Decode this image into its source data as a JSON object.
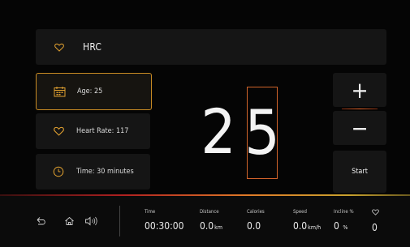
{
  "header": {
    "title": "HRC",
    "icon": "heart-icon"
  },
  "params": [
    {
      "label": "Age: 25",
      "icon": "calendar-icon",
      "active": true
    },
    {
      "label": "Heart Rate: 117",
      "icon": "heart-icon",
      "active": false
    },
    {
      "label": "Time:  30 minutes",
      "icon": "clock-icon",
      "active": false
    }
  ],
  "display": {
    "digit1": "2",
    "digit2": "5",
    "selected_digit": 2
  },
  "controls": {
    "plus": "+",
    "minus": "−",
    "start": "Start"
  },
  "footer": {
    "nav": [
      "back-icon",
      "home-icon",
      "sound-icon"
    ],
    "stats": {
      "time": {
        "label": "Time",
        "value": "00:30:00",
        "unit": ""
      },
      "distance": {
        "label": "Distance",
        "value": "0.0",
        "unit": "km"
      },
      "calories": {
        "label": "Calories",
        "value": "0.0",
        "unit": ""
      },
      "speed": {
        "label": "Speed",
        "value": "0.0",
        "unit": "km/h"
      },
      "incline": {
        "label": "Incline %",
        "value": "0",
        "unit": "%"
      },
      "heart": {
        "label_icon": "heart-icon",
        "value": "0"
      }
    }
  },
  "colors": {
    "accent_orange": "#e4652a",
    "accent_gold": "#c78a23",
    "background": "#050505",
    "panel": "#151515"
  }
}
